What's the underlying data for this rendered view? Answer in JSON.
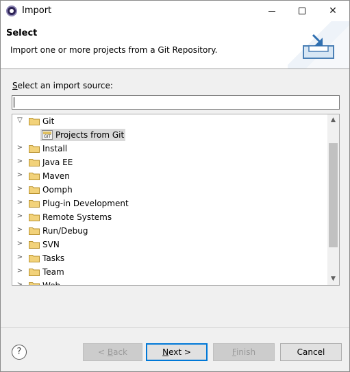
{
  "window": {
    "title": "Import"
  },
  "banner": {
    "title": "Select",
    "description": "Import one or more projects from a Git Repository."
  },
  "filter": {
    "label_mnemonic": "S",
    "label_rest": "elect an import source:",
    "value": ""
  },
  "tree": {
    "expanded": {
      "label": "Git",
      "child": "Projects from Git"
    },
    "items": [
      "Install",
      "Java EE",
      "Maven",
      "Oomph",
      "Plug-in Development",
      "Remote Systems",
      "Run/Debug",
      "SVN",
      "Tasks",
      "Team",
      "Web"
    ]
  },
  "buttons": {
    "help": "?",
    "back_prefix": "< ",
    "back_mnemonic": "B",
    "back_rest": "ack",
    "next_mnemonic": "N",
    "next_rest": "ext >",
    "finish_mnemonic": "F",
    "finish_rest": "inish",
    "cancel": "Cancel"
  }
}
